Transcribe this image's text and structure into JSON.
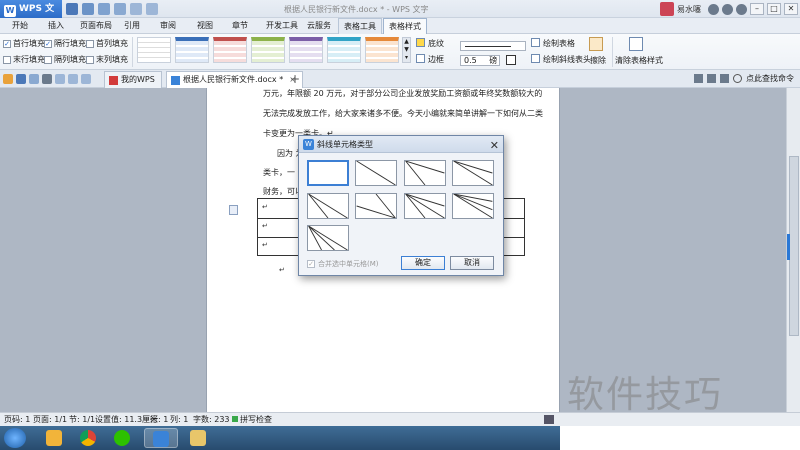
{
  "app": {
    "menu_button": "WPS 文字",
    "window_title": "根据人民银行新文件.docx * - WPS 文字",
    "user_name": "易水噻",
    "min": "–",
    "max": "□",
    "close": "✕"
  },
  "menu": {
    "items": [
      "开始",
      "插入",
      "页面布局",
      "引用",
      "审阅",
      "视图",
      "章节",
      "开发工具",
      "云服务",
      "表格工具",
      "表格样式"
    ],
    "active": "表格样式"
  },
  "ribbon": {
    "checkboxes": [
      {
        "label": "首行填充",
        "checked": true
      },
      {
        "label": "隔行填充",
        "checked": true
      },
      {
        "label": "首列填充",
        "checked": false
      },
      {
        "label": "末行填充",
        "checked": false
      },
      {
        "label": "隔列填充",
        "checked": false
      },
      {
        "label": "末列填充",
        "checked": false
      }
    ],
    "shading_label": "底纹",
    "border_label": "边框",
    "line_width": "0.5",
    "line_unit": "磅",
    "draw_table": "绘制表格",
    "draw_diagonal": "绘制斜线表头",
    "erase": "擦除",
    "clear_style": "清除表格样式",
    "style_colors": [
      "#444444",
      "#444444",
      "#3a6fb8",
      "#c0504d",
      "#8db24a",
      "#7b5ea7",
      "#31a3c6",
      "#e5893a"
    ]
  },
  "doc_tabs": {
    "tabs": [
      {
        "label": "我的WPS",
        "active": false
      },
      {
        "label": "根据人民银行新文件.docx *",
        "active": true
      }
    ],
    "close": "×",
    "plus": "+",
    "right_label": "点此查找命令"
  },
  "document": {
    "lines": [
      "万元，年限额 20 万元，对于部分公司企业发放奖励工资额或年终奖数额较大的",
      "无法完成发放工作，给大家来诸多不便。今天小编就来简单讲解一下如何从二类",
      "卡变更为一类卡。↵",
      "因为                                                                为二",
      "类卡，一                                                            公司",
      "财务，可以"
    ],
    "cell_mark": "↵"
  },
  "dialog": {
    "title": "斜线单元格类型",
    "close": "✕",
    "merge_label": "合并选中单元格(M)",
    "ok": "确定",
    "cancel": "取消",
    "selected_index": 0
  },
  "status": {
    "page": "页码: 1",
    "pages": "页面: 1/1",
    "section": "节: 1/1",
    "setting": "设置值: 11.3厘米",
    "row": "行: 1",
    "col": "列: 1",
    "words": "字数: 233",
    "spell": "拼写检查"
  },
  "watermark": "软件技巧"
}
